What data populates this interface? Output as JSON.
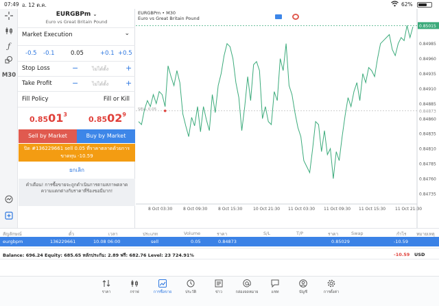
{
  "status_bar": {
    "time": "07:49",
    "date": "อ. 12 ต.ค.",
    "battery": "62%"
  },
  "left_toolbar": {
    "timeframe": "M30"
  },
  "order_panel": {
    "symbol": "EURGBPm",
    "description": "Euro vs Great Britain Pound",
    "execution": "Market Execution",
    "volume_steps": [
      "-0.5",
      "-0.1",
      "0.05",
      "+0.1",
      "+0.5"
    ],
    "stop_loss_label": "Stop Loss",
    "stop_loss_placeholder": "ไม่ได้ตั้ง",
    "take_profit_label": "Take Profit",
    "take_profit_placeholder": "ไม่ได้ตั้ง",
    "fill_policy_label": "Fill Policy",
    "fill_policy_value": "Fill or Kill",
    "bid": {
      "main": "0.85",
      "big": "01",
      "sup": "3"
    },
    "ask": {
      "main": "0.85",
      "big": "02",
      "sup": "9"
    },
    "sell_label": "Sell by Market",
    "buy_label": "Buy by Market",
    "close_notice": "ปิด #136229661 sell 0.05 ที่ราคาตลาดด้วยการขาดทุน -10.59",
    "cancel_label": "ยกเลิก",
    "warning": "คำเตือน! การซื้อขายจะถูกดำเนินการตามสภาพตลาด ความแตกต่างกับราคาที่ร้องขอมีมาก!",
    "colors": {
      "sell": "#e05a4f",
      "buy": "#3d86e8",
      "notice": "#f39c12",
      "price": "#e0403a"
    }
  },
  "chart": {
    "header_symbol": "EURGBPm • M30",
    "header_desc": "Euro vs Great Britain Pound",
    "sell_marker": "SELL 0.05",
    "current_price": "0.85013",
    "line_color": "#3aaa7a"
  },
  "chart_data": {
    "type": "line",
    "x_ticks": [
      "8 Oct 03:30",
      "8 Oct 09:30",
      "8 Oct 15:30",
      "10 Oct 21:30",
      "11 Oct 03:30",
      "11 Oct 09:30",
      "11 Oct 15:30",
      "11 Oct 21:30"
    ],
    "y_ticks": [
      "0.85015",
      "0.84985",
      "0.84960",
      "0.84935",
      "0.84910",
      "0.84885",
      "0.84873",
      "0.84860",
      "0.84835",
      "0.84810",
      "0.84785",
      "0.84760",
      "0.84735"
    ],
    "ylim": [
      0.8472,
      0.8502
    ],
    "entry_price": 0.84873,
    "values": [
      0.84855,
      0.8485,
      0.84875,
      0.8489,
      0.8488,
      0.849,
      0.84885,
      0.84905,
      0.849,
      0.8488,
      0.84948,
      0.8493,
      0.84915,
      0.8494,
      0.8492,
      0.84868,
      0.84848,
      0.8483,
      0.84862,
      0.84848,
      0.8488,
      0.84838,
      0.8488,
      0.84858,
      0.8484,
      0.849,
      0.8487,
      0.84915,
      0.84935,
      0.84965,
      0.84985,
      0.8498,
      0.8496,
      0.8492,
      0.84895,
      0.8484,
      0.8488,
      0.8493,
      0.8489,
      0.8495,
      0.84955,
      0.8494,
      0.8486,
      0.8488,
      0.84855,
      0.8485,
      0.84905,
      0.8489,
      0.8496,
      0.8494,
      0.84985,
      0.84915,
      0.849,
      0.8487,
      0.84845,
      0.8483,
      0.8479,
      0.8478,
      0.8477,
      0.8481,
      0.84855,
      0.8485,
      0.84805,
      0.8484,
      0.848,
      0.8481,
      0.8476,
      0.84805,
      0.8479,
      0.8483,
      0.84865,
      0.84895,
      0.8488,
      0.84905,
      0.8492,
      0.8489,
      0.84935,
      0.8492,
      0.84945,
      0.8494,
      0.8493,
      0.8496,
      0.84985,
      0.8499,
      0.84995,
      0.85,
      0.84975,
      0.84965,
      0.84985,
      0.84995,
      0.8499,
      0.85015,
      0.84995,
      0.85013
    ]
  },
  "positions": {
    "headers": [
      "สัญลักษณ์",
      "ตั๋ว",
      "เวลา",
      "ประเภท",
      "Volume",
      "ราคา",
      "S/L",
      "T/P",
      "ราคา",
      "Swap",
      "กำไร",
      "หมายเหตุ"
    ],
    "row": {
      "symbol": "eurgbpm",
      "ticket": "136229661",
      "time": "10.08 06:00",
      "type": "sell",
      "volume": "0.05",
      "price": "0.84873",
      "sl": "",
      "tp": "",
      "current": "0.85029",
      "swap": "",
      "profit": "-10.59",
      "comment": ""
    },
    "balance_text": "Balance: 696.24 Equity: 685.65 หลักประกัน: 2.89 ฟรี: 682.76 Level: 23 724.91%",
    "total_profit": "-10.59",
    "currency": "USD"
  },
  "nav": [
    {
      "label": "ราคา",
      "icon": "quotes-icon"
    },
    {
      "label": "กราฟ",
      "icon": "chart-icon"
    },
    {
      "label": "การซื้อขาย",
      "icon": "trade-icon"
    },
    {
      "label": "ประวัติ",
      "icon": "history-icon"
    },
    {
      "label": "ข่าว",
      "icon": "news-icon"
    },
    {
      "label": "กล่องจดหมาย",
      "icon": "mailbox-icon"
    },
    {
      "label": "แชท",
      "icon": "chat-icon"
    },
    {
      "label": "บัญชี",
      "icon": "account-icon"
    },
    {
      "label": "การตั้งค่า",
      "icon": "settings-icon"
    }
  ]
}
